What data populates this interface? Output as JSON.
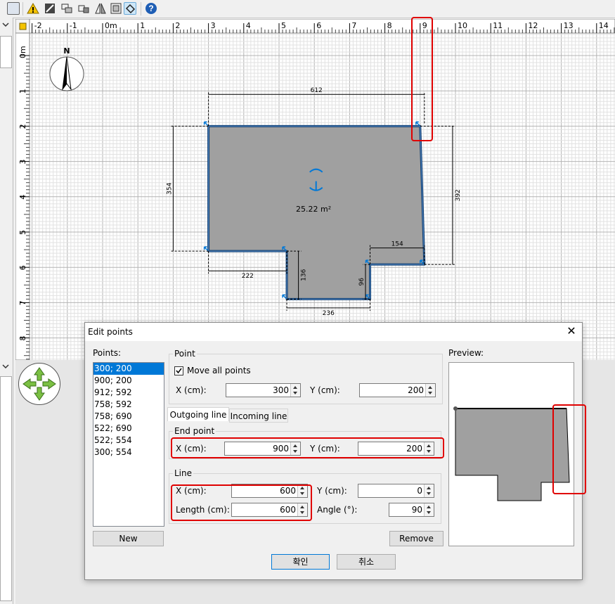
{
  "toolbar": {
    "icons": [
      "plan-view-icon",
      "warning-icon",
      "create-walls-icon",
      "create-rooms-icon",
      "create-dimensions-icon",
      "flip-icon",
      "text-icon",
      "edit-points-icon",
      "help-icon"
    ]
  },
  "plan": {
    "ruler_top": [
      "-2",
      "-1",
      "0m",
      "1",
      "2",
      "3",
      "4",
      "5",
      "6",
      "7",
      "8",
      "9",
      "10",
      "11",
      "12",
      "13",
      "14"
    ],
    "ruler_left": [
      "0m",
      "1",
      "2",
      "3",
      "4",
      "5",
      "6",
      "7",
      "8"
    ],
    "compass_label": "N",
    "room_area": "25.22 m²",
    "dimensions": {
      "top_width": "612",
      "left_height": "354",
      "right_height": "392",
      "bottom_left": "222",
      "notch_left_height": "136",
      "notch_right_width": "154",
      "notch_right_height": "96",
      "bottom_width": "236"
    }
  },
  "dialog": {
    "title": "Edit points",
    "close": "✕",
    "points_label": "Points:",
    "points": [
      "300; 200",
      "900; 200",
      "912; 592",
      "758; 592",
      "758; 690",
      "522; 690",
      "522; 554",
      "300; 554"
    ],
    "selected_point": 0,
    "point_group": {
      "title": "Point",
      "move_all_label": "Move all points",
      "move_all_checked": true,
      "x_label": "X (cm):",
      "x_value": "300",
      "y_label": "Y (cm):",
      "y_value": "200"
    },
    "tabs": [
      "Outgoing line",
      "Incoming line"
    ],
    "active_tab": 0,
    "end_point_group": {
      "title": "End point",
      "x_label": "X (cm):",
      "x_value": "900",
      "y_label": "Y (cm):",
      "y_value": "200"
    },
    "line_group": {
      "title": "Line",
      "x_label": "X (cm):",
      "x_value": "600",
      "y_label": "Y (cm):",
      "y_value": "0",
      "length_label": "Length (cm):",
      "length_value": "600",
      "angle_label": "Angle (°):",
      "angle_value": "90"
    },
    "preview_label": "Preview:",
    "new_button": "New",
    "remove_button": "Remove",
    "ok_button": "확인",
    "cancel_button": "취소"
  },
  "colors": {
    "room_fill": "#a0a0a0",
    "room_outline": "#0b3a6e",
    "selection": "#0078d7",
    "highlight": "#e00000",
    "grid_major": "#b4b4b4",
    "grid_minor": "#e2e2e2"
  }
}
